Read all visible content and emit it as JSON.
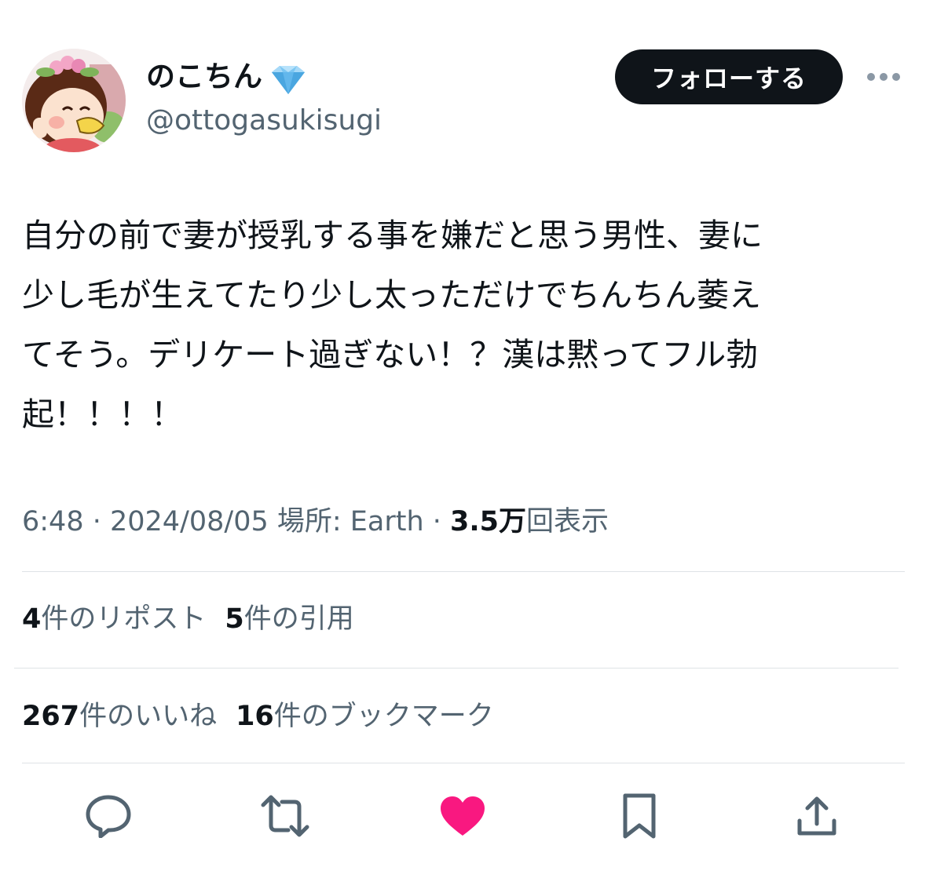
{
  "author": {
    "display_name": "のこちん",
    "handle": "@ottogasukisugi",
    "avatar_icon": "cartoon-girl-avatar",
    "verified_icon": "diamond-icon"
  },
  "follow_button": {
    "label": "フォローする"
  },
  "more_icon": "more-horizontal-icon",
  "tweet": {
    "lines": [
      "自分の前で妻が授乳する事を嫌だと思う男性、妻に",
      "少し毛が生えてたり少し太っただけでちんちん萎え",
      "てそう。デリケート過ぎない！？漢は黙ってフル勃",
      "起！！！！"
    ]
  },
  "meta": {
    "time": "6:48",
    "separator1": " · ",
    "date": "2024/08/05",
    "location": " 場所: Earth",
    "separator2": " · ",
    "views_num": "3.5万",
    "views_label": "回表示"
  },
  "stats": {
    "reposts_num": "4",
    "reposts_label": "件のリポスト",
    "quotes_num": "5",
    "quotes_label": "件の引用",
    "likes_num": "267",
    "likes_label": "件のいいね",
    "bookmarks_num": "16",
    "bookmarks_label": "件のブックマーク"
  },
  "actions": [
    {
      "name": "reply-icon"
    },
    {
      "name": "repost-icon"
    },
    {
      "name": "like-icon",
      "active": true
    },
    {
      "name": "bookmark-icon"
    },
    {
      "name": "share-icon"
    }
  ],
  "colors": {
    "text": "#0f1419",
    "secondary": "#536471",
    "like": "#f91880",
    "button_bg": "#0f1419",
    "button_text": "#ffffff",
    "divider": "#dfe3e6"
  }
}
